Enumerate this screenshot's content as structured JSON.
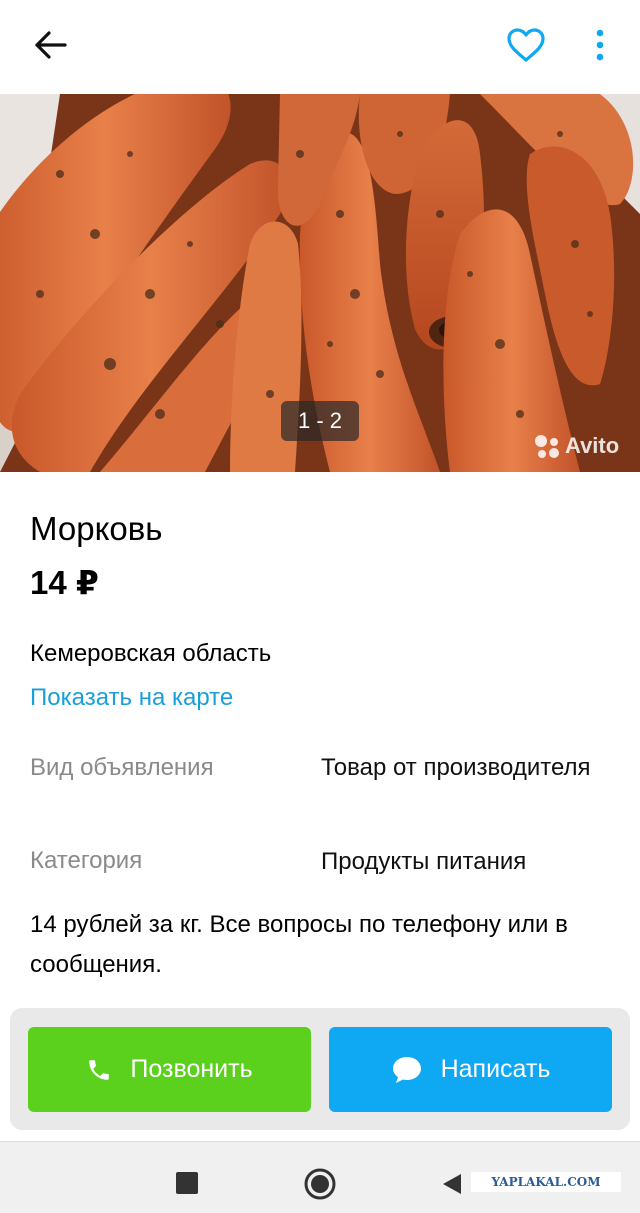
{
  "header": {
    "back_icon": "arrow-left-icon",
    "favorite_icon": "heart-outline-icon",
    "menu_icon": "more-vertical-icon"
  },
  "gallery": {
    "counter": "1 - 2",
    "watermark": "Avito"
  },
  "listing": {
    "title": "Морковь",
    "price": "14 ₽",
    "region": "Кемеровская область",
    "map_link": "Показать на карте",
    "properties": [
      {
        "label": "Вид объявления",
        "value": "Товар от производителя"
      },
      {
        "label": "Категория",
        "value": "Продукты питания"
      }
    ],
    "description": "14 рублей за кг. Все вопросы по телефону или в сообщения."
  },
  "actions": {
    "call": {
      "label": "Позвонить",
      "icon": "phone-icon",
      "color": "#5bd11d"
    },
    "write": {
      "label": "Написать",
      "icon": "chat-bubble-icon",
      "color": "#0fa8f2"
    }
  },
  "system_nav": {
    "recent_icon": "square-icon",
    "home_icon": "circle-icon",
    "back_icon": "triangle-back-icon"
  },
  "overlay_watermark": "YAPLAKAL.COM",
  "colors": {
    "accent_link": "#1a9fd8",
    "favorite_icon": "#0fa8f2"
  }
}
